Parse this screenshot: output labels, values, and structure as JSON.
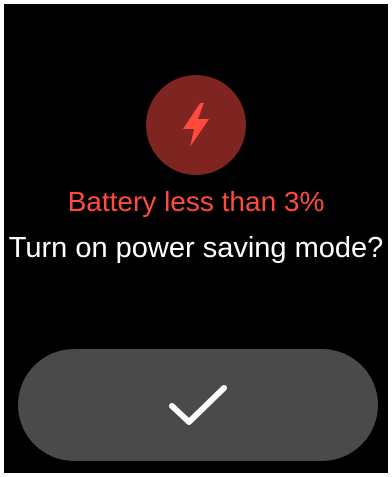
{
  "dialog": {
    "icon": "lightning-bolt-icon",
    "warning": "Battery less than 3%",
    "question": "Turn on power saving mode?",
    "confirm_icon": "checkmark-icon"
  },
  "colors": {
    "background": "#000000",
    "icon_circle": "#7e2421",
    "icon": "#ff4a3d",
    "warning_text": "#ff4a3d",
    "question_text": "#ffffff",
    "button": "#4a4a4a",
    "checkmark": "#ffffff"
  }
}
